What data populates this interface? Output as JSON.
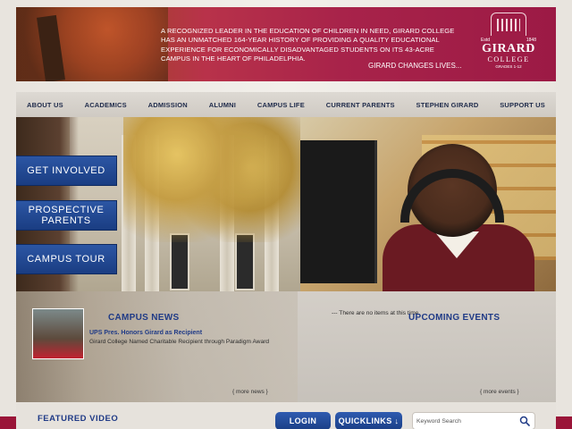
{
  "header": {
    "intro": "A RECOGNIZED LEADER IN THE EDUCATION OF CHILDREN IN NEED, GIRARD COLLEGE HAS AN UNMATCHED 164-YEAR HISTORY OF PROVIDING A QUALITY EDUCATIONAL EXPERIENCE FOR ECONOMICALLY DISADVANTAGED STUDENTS ON ITS 43-ACRE CAMPUS IN THE HEART OF PHILADELPHIA.",
    "tagline": "GIRARD CHANGES LIVES...",
    "logo": {
      "est_left": "Estd",
      "est_right": "1848",
      "name": "GIRARD",
      "college": "COLLEGE",
      "grades": "GRADES 1-12"
    }
  },
  "nav": {
    "items": [
      {
        "label": "ABOUT US"
      },
      {
        "label": "ACADEMICS"
      },
      {
        "label": "ADMISSION"
      },
      {
        "label": "ALUMNI"
      },
      {
        "label": "CAMPUS LIFE"
      },
      {
        "label": "CURRENT PARENTS"
      },
      {
        "label": "STEPHEN GIRARD"
      },
      {
        "label": "SUPPORT US"
      }
    ]
  },
  "hero": {
    "buttons": [
      {
        "label": "GET INVOLVED"
      },
      {
        "label": "PROSPECTIVE PARENTS"
      },
      {
        "label": "CAMPUS TOUR"
      }
    ]
  },
  "news": {
    "heading": "CAMPUS NEWS",
    "headline": "UPS Pres. Honors Girard as Recipient",
    "subline": "Girard College Named Charitable Recipient through Paradigm Award",
    "more": "{ more news }"
  },
  "events": {
    "heading": "UPCOMING EVENTS",
    "empty": "--- There are no items at this time.",
    "more": "{ more events }"
  },
  "footer": {
    "featured": "FEATURED VIDEO",
    "login": "LOGIN",
    "quicklinks": "QUICKLINKS ↓",
    "search_placeholder": "Keyword Search"
  },
  "colors": {
    "brand": "#9c1a45",
    "nav_text": "#1e2a4a",
    "button_blue": "#1a3d82",
    "heading_blue": "#1f3a86"
  }
}
